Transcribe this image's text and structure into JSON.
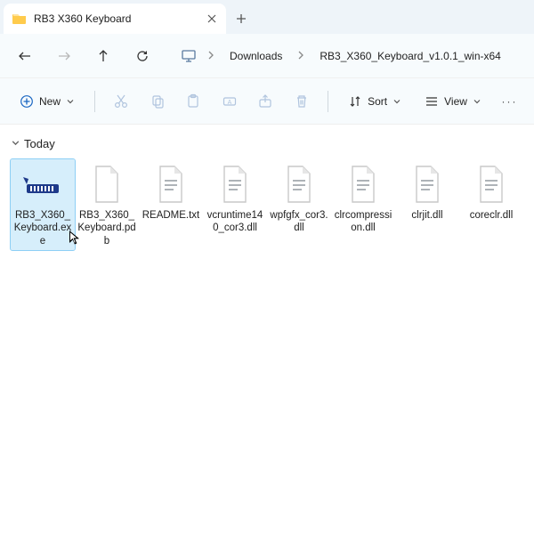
{
  "tab": {
    "title": "RB3 X360 Keyboard"
  },
  "breadcrumb": {
    "seg1": "Downloads",
    "seg2": "RB3_X360_Keyboard_v1.0.1_win-x64"
  },
  "toolbar": {
    "new": "New",
    "sort": "Sort",
    "view": "View"
  },
  "group": {
    "label": "Today"
  },
  "files": [
    {
      "name": "RB3_X360_Keyboard.exe"
    },
    {
      "name": "RB3_X360_Keyboard.pdb"
    },
    {
      "name": "README.txt"
    },
    {
      "name": "vcruntime140_cor3.dll"
    },
    {
      "name": "wpfgfx_cor3.dll"
    },
    {
      "name": "clrcompression.dll"
    },
    {
      "name": "clrjit.dll"
    },
    {
      "name": "coreclr.dll"
    }
  ]
}
